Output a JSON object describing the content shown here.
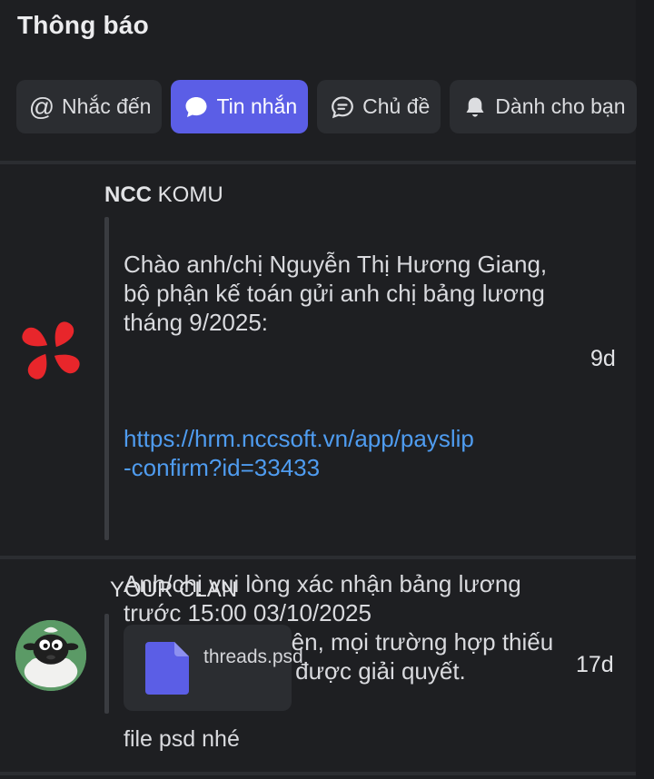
{
  "header": {
    "title": "Thông báo"
  },
  "tabs": [
    {
      "label": "Nhắc đến",
      "icon": "at-icon",
      "active": false
    },
    {
      "label": "Tin nhắn",
      "icon": "chat-bubble-icon",
      "active": true
    },
    {
      "label": "Chủ đề",
      "icon": "thread-icon",
      "active": false
    },
    {
      "label": "Dành cho bạn",
      "icon": "bell-icon",
      "active": false
    }
  ],
  "notifications": [
    {
      "sender_bold": "NCC",
      "sender_rest": " KOMU",
      "avatar": "ncc-logo",
      "message_intro": "Chào anh/chị Nguyễn Thị Hương Giang,\nbộ phận kế toán gửi anh chị bảng lương\ntháng 9/2025:",
      "message_link": "https://hrm.nccsoft.vn/app/payslip\n-confirm?id=33433",
      "message_outro": "Anh/chị vui lòng xác nhận bảng lương\ntrước 15:00 03/10/2025\nSau thời điểm trên, mọi trường hợp thiếu\nlương sẽ không được giải quyết.",
      "time": "9d"
    },
    {
      "sender": "YOUR CLAN",
      "avatar": "sheep-avatar",
      "file_name": "threads.psd",
      "caption": "file psd nhé",
      "time": "17d"
    }
  ],
  "colors": {
    "accent": "#5b5ee6",
    "link": "#4f9cf0",
    "background": "#1e1f22",
    "logo_red": "#e8262b"
  }
}
